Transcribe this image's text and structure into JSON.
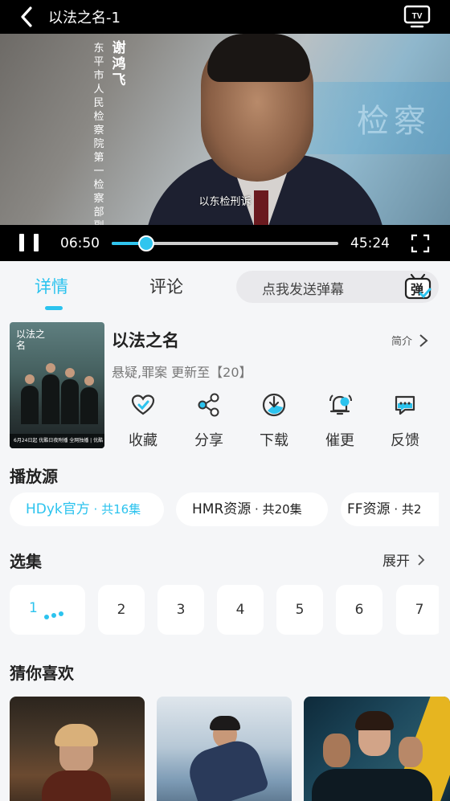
{
  "player": {
    "title": "以法之名-1",
    "tv_icon": "tv-cast-icon",
    "speaker_name": "谢鸿飞",
    "speaker_role": "东平市人民检察院第一检察部副主任",
    "subtitle": "以东检刑诉",
    "current_time": "06:50",
    "total_time": "45:24",
    "progress_fraction": 0.151
  },
  "tabs": {
    "details": "详情",
    "comments": "评论",
    "danmaku_placeholder": "点我发送弹幕",
    "danmaku_icon_char": "弹"
  },
  "show": {
    "title": "以法之名",
    "intro_link": "简介",
    "meta": "悬疑,罪案 更新至【20】",
    "poster_title": "以法之名",
    "poster_strip": "6月24日起 优酷日夜附播 全网独播 | 优酷 酷喵TV",
    "actions": [
      {
        "label": "收藏",
        "icon": "heart-icon"
      },
      {
        "label": "分享",
        "icon": "share-icon"
      },
      {
        "label": "下载",
        "icon": "download-icon"
      },
      {
        "label": "催更",
        "icon": "bell-icon"
      },
      {
        "label": "反馈",
        "icon": "feedback-icon"
      }
    ]
  },
  "sources": {
    "title": "播放源",
    "items": [
      {
        "name": "HDyk官方",
        "count": " · 共16集",
        "active": true
      },
      {
        "name": "HMR资源",
        "count": " · 共20集",
        "active": false
      },
      {
        "name": "FF资源",
        "count": " · 共2",
        "active": false
      }
    ]
  },
  "episodes": {
    "title": "选集",
    "expand": "展开",
    "items": [
      "1",
      "2",
      "3",
      "4",
      "5",
      "6",
      "7"
    ],
    "active_index": 0
  },
  "recommend": {
    "title": "猜你喜欢"
  },
  "colors": {
    "accent": "#2cc3ee",
    "background": "#f5f6f8"
  }
}
